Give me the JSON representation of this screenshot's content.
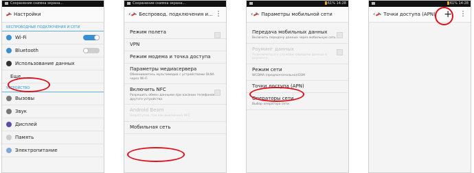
{
  "screen1": {
    "status_text": "Сохранение снимка экрана...",
    "title": "Настройки",
    "section_wireless": "БЕСПРОВОДНЫЕ ПОДКЛЮЧЕНИЯ И СЕТИ",
    "rows_wireless": [
      {
        "label": "Wi-Fi",
        "icon": "wifi-icon",
        "color": "#3a8fd0",
        "toggle": "on"
      },
      {
        "label": "Bluetooth",
        "icon": "bluetooth-icon",
        "color": "#3a8fd0",
        "toggle": "off"
      },
      {
        "label": "Использование данных",
        "icon": "data-usage-icon",
        "color": "#333333"
      },
      {
        "label": "Еще...",
        "icon": "",
        "color": ""
      }
    ],
    "section_device": "УСТРОЙСТВО",
    "rows_device": [
      {
        "label": "Вызовы",
        "icon": "phone-icon",
        "color": "#777777"
      },
      {
        "label": "Звук",
        "icon": "equalizer-icon",
        "color": "#777777"
      },
      {
        "label": "Дисплей",
        "icon": "display-icon",
        "color": "#5a4fa3"
      },
      {
        "label": "Память",
        "icon": "memory-icon",
        "color": "#cccccc"
      },
      {
        "label": "Электропитание",
        "icon": "power-icon",
        "color": "#7fa7d8"
      }
    ]
  },
  "screen2": {
    "status_text": "Сохранение снимка экрана...",
    "title": "Беспровод. подключения и...",
    "items": [
      {
        "title": "Режим полета",
        "sub": "",
        "checkbox": true,
        "disabled": false
      },
      {
        "title": "VPN",
        "sub": "",
        "checkbox": false,
        "disabled": false
      },
      {
        "title": "Режим модема и точка доступа",
        "sub": "",
        "checkbox": false,
        "disabled": false
      },
      {
        "title": "Параметры медиасервера",
        "sub": "Обмениваетесь мультимедиа с устройствами DLNA через Wi-Fi",
        "checkbox": false,
        "disabled": false
      },
      {
        "title": "Включить NFC",
        "sub": "Разрешить обмен данными при касании телефоном другого устройства",
        "checkbox": true,
        "disabled": false
      },
      {
        "title": "Android Beam",
        "sub": "Недоступно, так как выключена NFC",
        "checkbox": false,
        "disabled": true
      },
      {
        "title": "Мобильная сеть",
        "sub": "",
        "checkbox": false,
        "disabled": false
      }
    ]
  },
  "screen3": {
    "status_right": "61% 14:28",
    "title": "Параметры мобильной сети",
    "items": [
      {
        "title": "Передача мобильных данных",
        "sub": "Включить передачу данных через мобильную сеть",
        "checkbox": true,
        "disabled": false
      },
      {
        "title": "Роуминг данных",
        "sub": "Подключаться к службам передачи данных в роуминге",
        "checkbox": true,
        "disabled": true
      },
      {
        "title": "Режим сети",
        "sub": "WCDMA (предпочтительно)/GSM",
        "checkbox": false,
        "disabled": false
      },
      {
        "title": "Точки доступа (APN)",
        "sub": "",
        "checkbox": false,
        "disabled": false
      },
      {
        "title": "Операторы сети",
        "sub": "Выбор оператора сети",
        "checkbox": false,
        "disabled": false
      }
    ]
  },
  "screen4": {
    "status_right": "61% 14:28",
    "title": "Точки доступа (APN)",
    "add_label": "+",
    "menu_label": "⋮"
  },
  "colors": {
    "highlight": "#e0101a",
    "accent": "#2f9ad3"
  }
}
